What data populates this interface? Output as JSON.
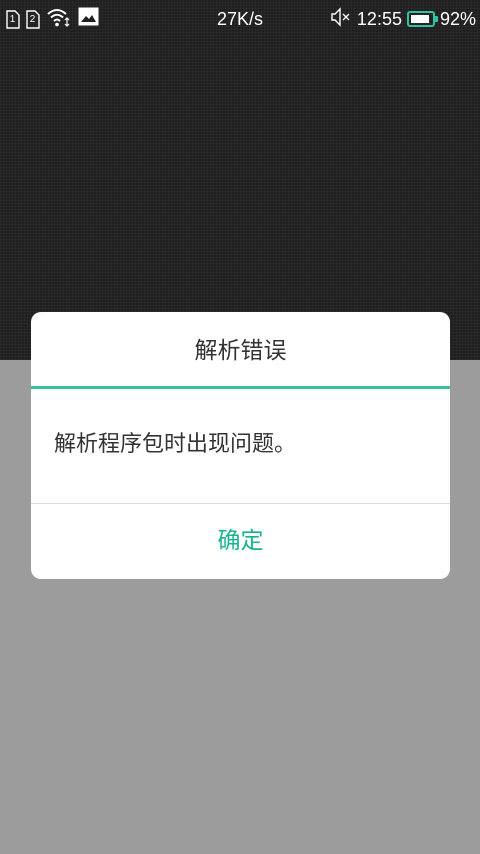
{
  "status_bar": {
    "sim1_label": "1",
    "sim2_label": "2",
    "icons": [
      "sim-card-icon",
      "sim-card-icon",
      "wifi-icon",
      "image-notification-icon",
      "mute-icon",
      "battery-icon"
    ],
    "network_speed": "27K/s",
    "time": "12:55",
    "battery_percent": "92%",
    "battery_level": 0.92,
    "battery_color": "#35c2a0"
  },
  "dialog": {
    "title": "解析错误",
    "message": "解析程序包时出现问题。",
    "ok_label": "确定",
    "accent_color": "#35c2a0",
    "button_color": "#19b393"
  }
}
